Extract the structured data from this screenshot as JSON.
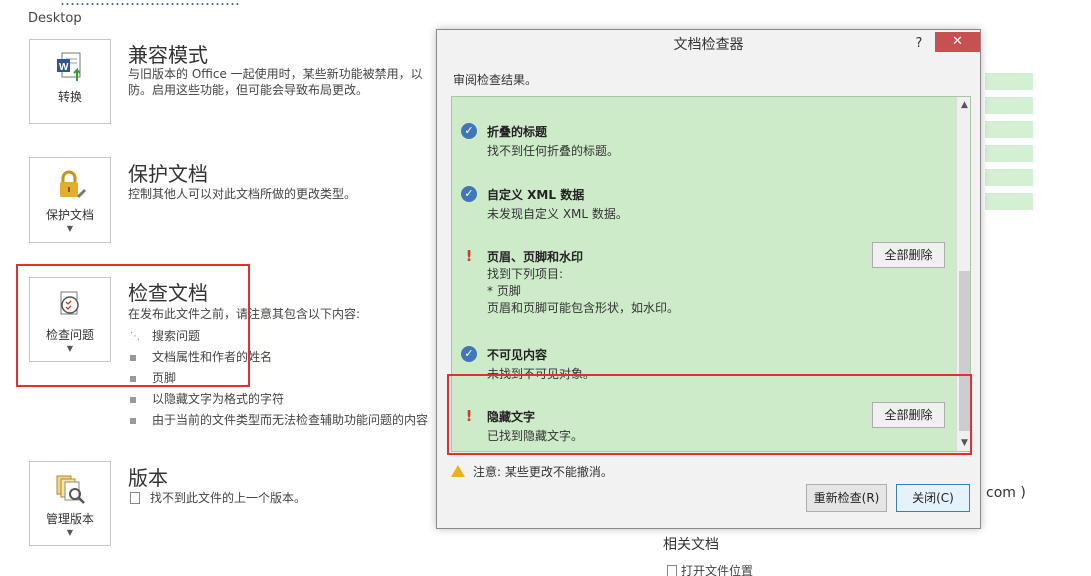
{
  "backstage": {
    "top_cut_text": "………………………………",
    "location": "Desktop",
    "sections": [
      {
        "tile_label": "转换",
        "title": "兼容模式",
        "desc": "与旧版本的 Office 一起使用时，某些新功能被禁用，以防。启用这些功能，但可能会导致布局更改。"
      },
      {
        "tile_label": "保护文档",
        "title": "保护文档",
        "desc": "控制其他人可以对此文档所做的更改类型。"
      },
      {
        "tile_label": "检查问题",
        "title": "检查文档",
        "desc": "在发布此文件之前，请注意其包含以下内容:",
        "bullets": [
          "搜索问题",
          "文档属性和作者的姓名",
          "页脚",
          "以隐藏文字为格式的字符",
          "由于当前的文件类型而无法检查辅助功能问题的内容"
        ]
      },
      {
        "tile_label": "管理版本",
        "title": "版本",
        "desc": "找不到此文件的上一个版本。"
      }
    ],
    "right_suffix": "com )",
    "related_docs": "相关文档",
    "open_location": "打开文件位置"
  },
  "dialog": {
    "title": "文档检查器",
    "help": "?",
    "close": "✕",
    "subtitle": "审阅检查结果。",
    "results": [
      {
        "status": "ok",
        "title": "折叠的标题",
        "lines": [
          "找不到任何折叠的标题。"
        ]
      },
      {
        "status": "ok",
        "title": "自定义 XML 数据",
        "lines": [
          "未发现自定义 XML 数据。"
        ]
      },
      {
        "status": "warn",
        "title": "页眉、页脚和水印",
        "lines": [
          "找到下列项目:",
          "* 页脚",
          "页眉和页脚可能包含形状，如水印。"
        ],
        "button": "全部删除"
      },
      {
        "status": "ok",
        "title": "不可见内容",
        "lines": [
          "未找到不可见对象。"
        ]
      },
      {
        "status": "warn",
        "title": "隐藏文字",
        "lines": [
          "已找到隐藏文字。"
        ],
        "button": "全部删除"
      }
    ],
    "note": "注意: 某些更改不能撤消。",
    "reinspect_label": "重新检查(R)",
    "close_label": "关闭(C)"
  },
  "colors": {
    "accent": "#2b5797",
    "highlight_red": "#e0312f",
    "results_bg": "#cdebc9",
    "check_blue": "#3f77b8",
    "warn_red": "#d43a2a"
  }
}
